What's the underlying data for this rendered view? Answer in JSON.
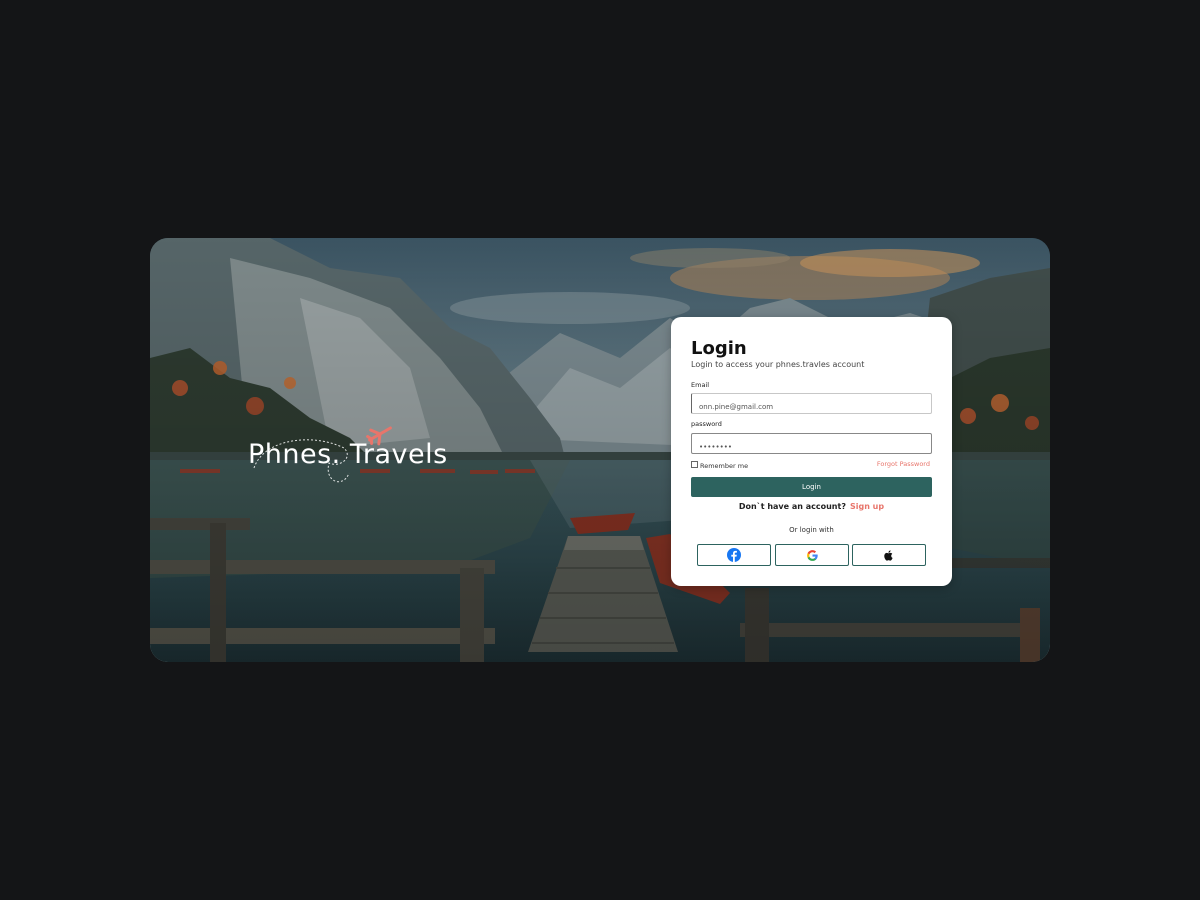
{
  "brand": {
    "name": "Phnes. Travels"
  },
  "login": {
    "title": "Login",
    "subtitle": "Login to access your phnes.travles account",
    "email_label": "Email",
    "email_value": "onn.pine@gmail.com",
    "password_label": "password",
    "password_value": "********",
    "remember_label": "Remember me",
    "forgot_label": "Forgot Password",
    "submit_label": "Login",
    "signup_prompt": "Don`t have an account?",
    "signup_link": "Sign up",
    "or_login_with": "Or login with"
  },
  "social": [
    {
      "name": "facebook-icon"
    },
    {
      "name": "google-icon"
    },
    {
      "name": "apple-icon"
    }
  ],
  "colors": {
    "page_background": "#141517",
    "primary_button": "#2d635f",
    "accent": "#e8756b",
    "facebook_blue": "#1877f2"
  }
}
